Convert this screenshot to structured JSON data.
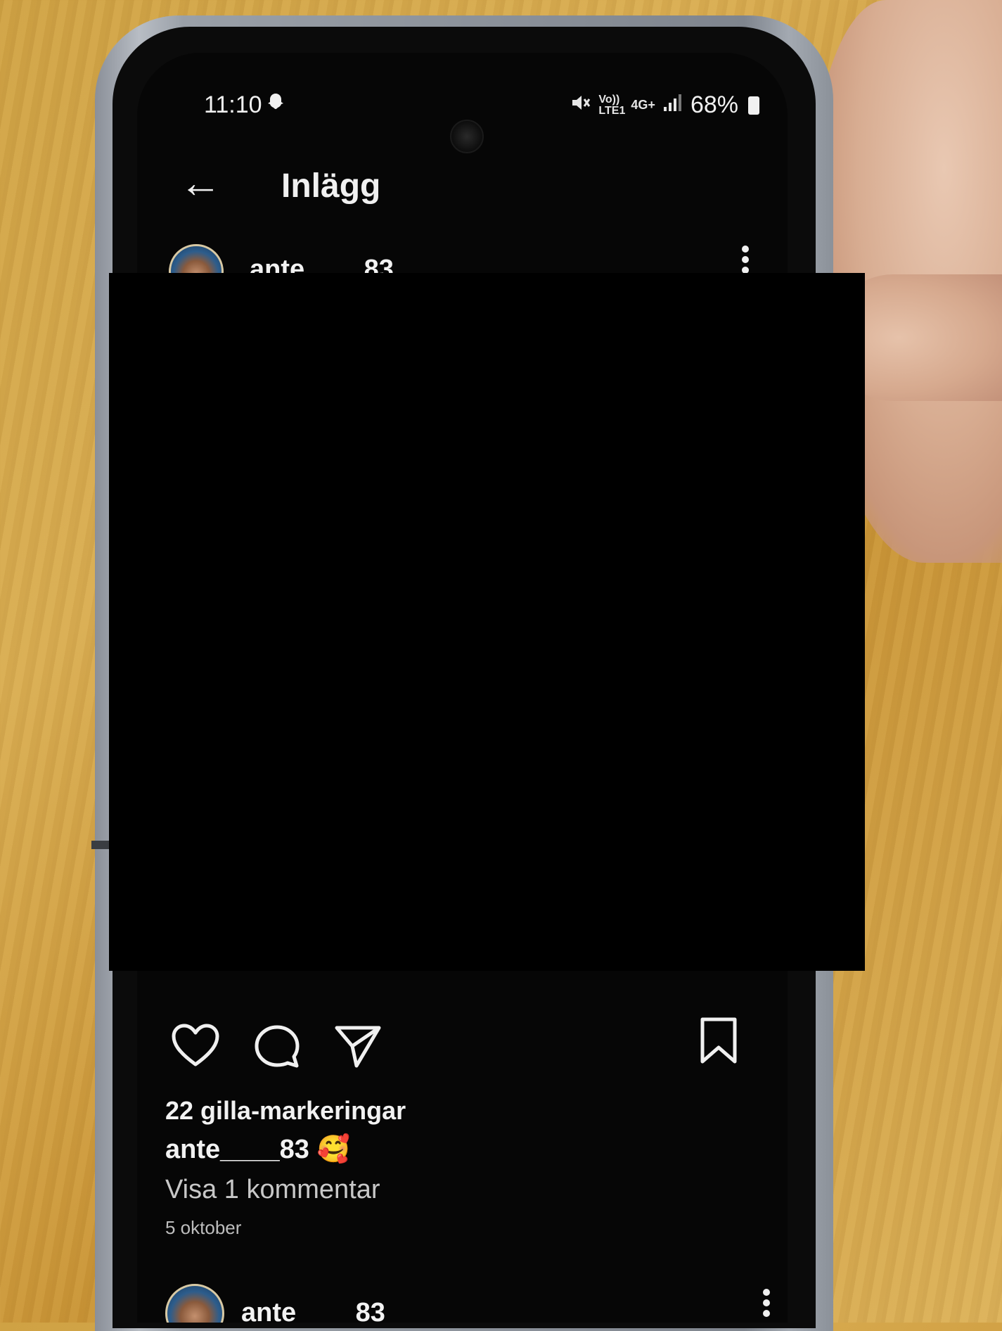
{
  "status_bar": {
    "time": "11:10",
    "snap_icon": "snapchat-ghost-icon",
    "network": "Vo)) LTE1",
    "data": "4G+",
    "battery": "68%"
  },
  "app_bar": {
    "title": "Inlägg"
  },
  "post": {
    "username": "ante____83",
    "likes": "22 gilla-markeringar",
    "caption_user": "ante____83",
    "caption_emoji": "🥰",
    "view_comments": "Visa 1 kommentar",
    "date": "5 oktober"
  },
  "next_post": {
    "username": "ante____83"
  },
  "icons": {
    "back": "←",
    "more": "⋮"
  }
}
